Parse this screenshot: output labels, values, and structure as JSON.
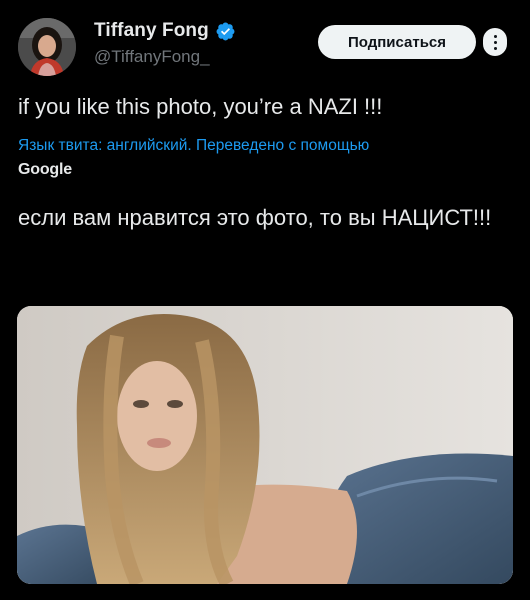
{
  "author": {
    "display_name": "Tiffany Fong",
    "handle": "@TiffanyFong_",
    "verified": true,
    "avatar_icon": "profile-photo"
  },
  "actions": {
    "subscribe_label": "Подписаться",
    "more_icon": "more-dots-icon"
  },
  "tweet": {
    "text": "if you like this photo, you’re a NAZI !!!",
    "translation_note": "Язык твита: английский. Переведено с помощью",
    "translation_provider": "Google",
    "translated_text": "если вам нравится это фото, то вы НАЦИСТ!!!"
  },
  "colors": {
    "background": "#000000",
    "link": "#1d9bf0",
    "verified": "#1d9bf0",
    "primary_text": "#e7e9ea",
    "secondary_text": "#71767b"
  }
}
